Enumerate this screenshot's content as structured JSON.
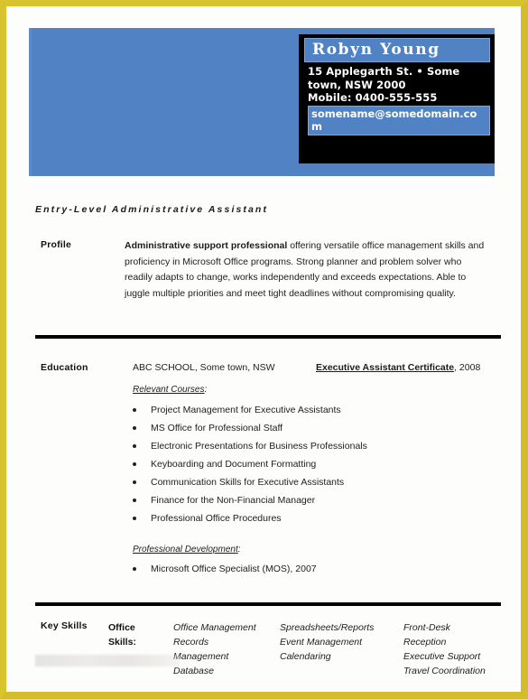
{
  "document": {
    "type": "resume-template",
    "border_color": "#d9c42e",
    "banner_color": "#5183c4",
    "contact_box_color": "#000000"
  },
  "header": {
    "name": "Robyn Young",
    "address_line1": "15 Applegarth St. • Some",
    "address_line2": "town, NSW 2000",
    "mobile": "Mobile: 0400-555-555",
    "email": "somename@somedomain.com"
  },
  "job_title": "Entry-Level Administrative Assistant",
  "profile": {
    "label": "Profile",
    "lead": "Administrative support professional",
    "text": " offering versatile office management skills and proficiency in Microsoft Office programs. Strong planner and problem solver who readily adapts to change, works independently and exceeds expectations. Able to juggle multiple priorities and meet tight deadlines without compromising quality."
  },
  "education": {
    "label": "Education",
    "school": "ABC SCHOOL, Some town, NSW",
    "certificate": "Executive Assistant Certificate",
    "certificate_year": ", 2008",
    "relevant_courses_heading": "Relevant Courses",
    "relevant_courses_colon": ":",
    "courses": [
      "Project Management for Executive Assistants",
      "MS Office for Professional Staff",
      "Electronic Presentations for Business Professionals",
      "Keyboarding and Document Formatting",
      "Communication Skills for Executive Assistants",
      "Finance for the Non-Financial Manager",
      "Professional Office Procedures"
    ],
    "professional_development_heading": "Professional Development",
    "professional_development_colon": ":",
    "professional_development": [
      "Microsoft Office Specialist (MOS), 2007"
    ]
  },
  "key_skills": {
    "label": "Key Skills",
    "category_line1": "Office",
    "category_line2": "Skills:",
    "column1": [
      "Office Management",
      "Records",
      "Management",
      "Database"
    ],
    "column2": [
      "Spreadsheets/Reports",
      "Event Management",
      "Calendaring"
    ],
    "column3": [
      "Front-Desk",
      "Reception",
      "Executive Support",
      "Travel Coordination"
    ]
  }
}
